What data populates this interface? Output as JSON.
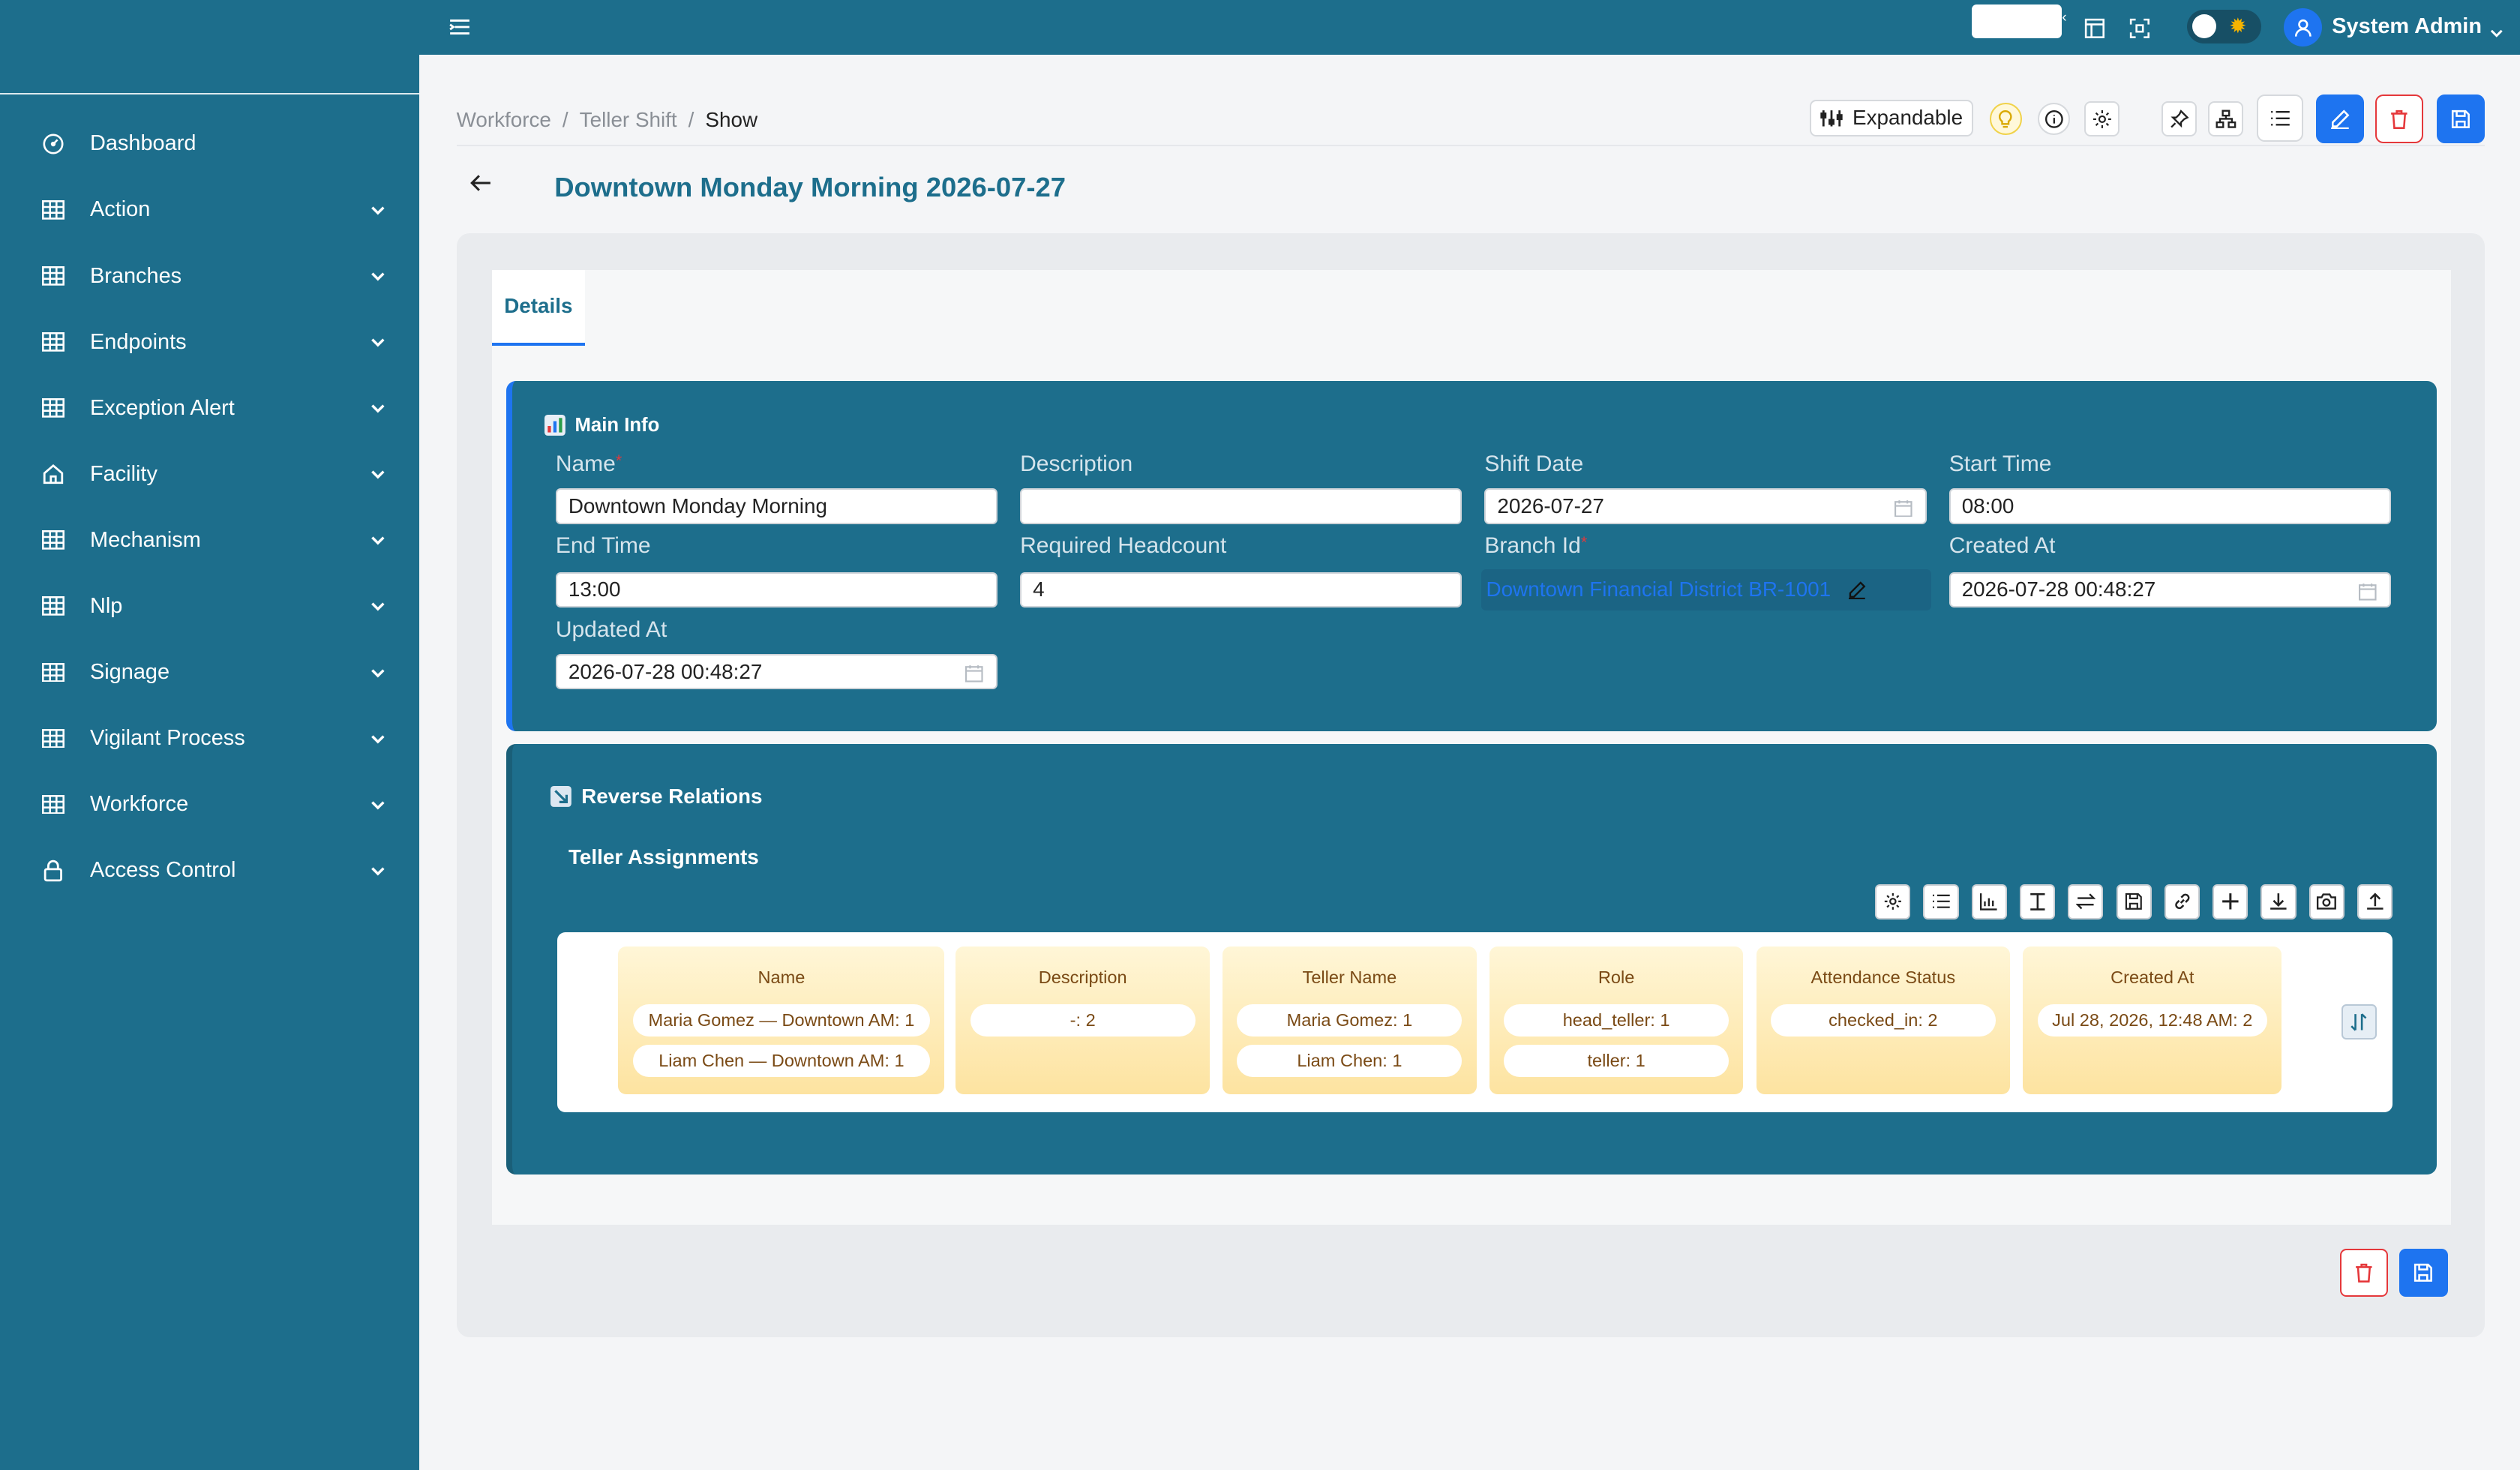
{
  "sidebar": {
    "items": [
      {
        "label": "Dashboard",
        "icon": "dashboard-icon"
      },
      {
        "label": "Action",
        "icon": "table-icon"
      },
      {
        "label": "Branches",
        "icon": "table-icon"
      },
      {
        "label": "Endpoints",
        "icon": "table-icon"
      },
      {
        "label": "Exception Alert",
        "icon": "table-icon"
      },
      {
        "label": "Facility",
        "icon": "home-icon"
      },
      {
        "label": "Mechanism",
        "icon": "table-icon"
      },
      {
        "label": "Nlp",
        "icon": "table-icon"
      },
      {
        "label": "Signage",
        "icon": "table-icon"
      },
      {
        "label": "Vigilant Process",
        "icon": "table-icon"
      },
      {
        "label": "Workforce",
        "icon": "table-icon"
      },
      {
        "label": "Access Control",
        "icon": "lock-icon"
      }
    ]
  },
  "topbar": {
    "user_name": "System Admin",
    "collapse_glyph": "‹"
  },
  "breadcrumb": {
    "items": [
      "Workforce",
      "Teller Shift",
      "Show"
    ],
    "separator": "/"
  },
  "toolbar": {
    "expandable_label": "Expandable"
  },
  "page": {
    "title": "Downtown Monday Morning 2026-07-27"
  },
  "tabs": [
    {
      "label": "Details",
      "active": true
    }
  ],
  "main_info": {
    "title": "Main Info",
    "fields": {
      "name": {
        "label": "Name",
        "value": "Downtown Monday Morning",
        "required": true
      },
      "description": {
        "label": "Description",
        "value": ""
      },
      "shift_date": {
        "label": "Shift Date",
        "value": "2026-07-27"
      },
      "start_time": {
        "label": "Start Time",
        "value": "08:00"
      },
      "end_time": {
        "label": "End Time",
        "value": "13:00"
      },
      "required_headcount": {
        "label": "Required Headcount",
        "value": "4"
      },
      "branch_id": {
        "label": "Branch Id",
        "value": "Downtown Financial District BR-1001",
        "required": true
      },
      "created_at": {
        "label": "Created At",
        "value": "2026-07-28 00:48:27"
      },
      "updated_at": {
        "label": "Updated At",
        "value": "2026-07-28 00:48:27"
      }
    },
    "required_mark": "*"
  },
  "reverse_relations": {
    "title": "Reverse Relations",
    "teller_assignments": {
      "title": "Teller Assignments",
      "toolbar_icons": [
        "gear-icon",
        "list-icon",
        "bar-chart-icon",
        "text-icon",
        "swap-icon",
        "save-icon",
        "link-icon",
        "plus-icon",
        "download-icon",
        "camera-icon",
        "upload-icon"
      ],
      "columns": [
        {
          "header": "Name",
          "values": [
            "Maria Gomez — Downtown AM: 1",
            "Liam Chen — Downtown AM: 1"
          ]
        },
        {
          "header": "Description",
          "values": [
            "-: 2"
          ]
        },
        {
          "header": "Teller Name",
          "values": [
            "Maria Gomez: 1",
            "Liam Chen: 1"
          ]
        },
        {
          "header": "Role",
          "values": [
            "head_teller: 1",
            "teller: 1"
          ]
        },
        {
          "header": "Attendance Status",
          "values": [
            "checked_in: 2"
          ]
        },
        {
          "header": "Created At",
          "values": [
            "Jul 28, 2026, 12:48 AM: 2"
          ]
        }
      ]
    }
  },
  "colors": {
    "primary": "#1d6e8c",
    "accent_blue": "#1e74f0",
    "danger": "#e5383b",
    "column_gradient": "#fde3a0"
  }
}
